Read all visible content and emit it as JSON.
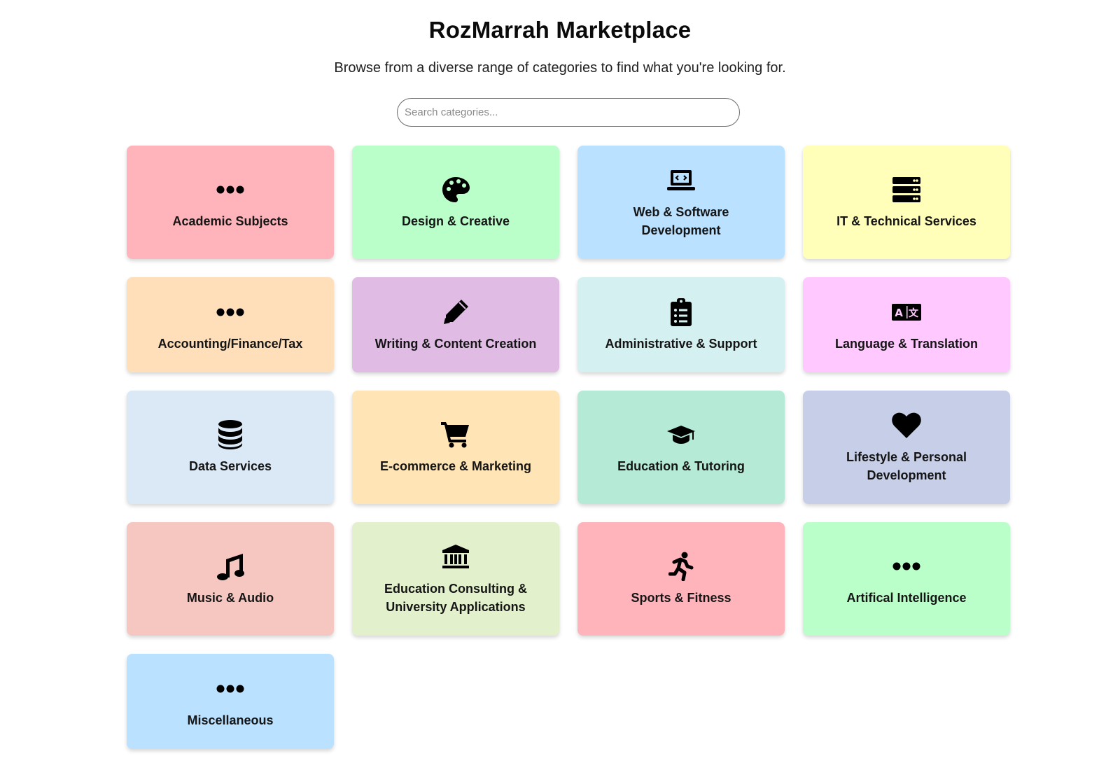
{
  "header": {
    "title": "RozMarrah Marketplace",
    "subtitle": "Browse from a diverse range of categories to find what you're looking for."
  },
  "search": {
    "placeholder": "Search categories...",
    "value": ""
  },
  "categories": [
    {
      "label": "Academic Subjects",
      "icon": "ellipsis-icon",
      "color": "#ffb3ba"
    },
    {
      "label": "Design & Creative",
      "icon": "palette-icon",
      "color": "#baffc9"
    },
    {
      "label": "Web & Software Development",
      "icon": "laptop-code-icon",
      "color": "#bae1ff"
    },
    {
      "label": "IT & Technical Services",
      "icon": "server-icon",
      "color": "#ffffba"
    },
    {
      "label": "Accounting/Finance/Tax",
      "icon": "ellipsis-icon",
      "color": "#ffdfba"
    },
    {
      "label": "Writing & Content Creation",
      "icon": "pencil-icon",
      "color": "#e0bbe4"
    },
    {
      "label": "Administrative & Support",
      "icon": "clipboard-list-icon",
      "color": "#d5f0f0"
    },
    {
      "label": "Language & Translation",
      "icon": "language-icon",
      "color": "#ffc8ff"
    },
    {
      "label": "Data Services",
      "icon": "database-icon",
      "color": "#dbe9f7"
    },
    {
      "label": "E-commerce & Marketing",
      "icon": "shopping-cart-icon",
      "color": "#ffe4b5"
    },
    {
      "label": "Education & Tutoring",
      "icon": "graduation-cap-icon",
      "color": "#b5ead7"
    },
    {
      "label": "Lifestyle & Personal Development",
      "icon": "heart-icon",
      "color": "#c7cee8"
    },
    {
      "label": "Music & Audio",
      "icon": "music-icon",
      "color": "#f6c7c0"
    },
    {
      "label": "Education Consulting & University Applications",
      "icon": "landmark-icon",
      "color": "#e2f0cb"
    },
    {
      "label": "Sports & Fitness",
      "icon": "running-icon",
      "color": "#ffb3ba"
    },
    {
      "label": "Artifical Intelligence",
      "icon": "ellipsis-icon",
      "color": "#baffc9"
    },
    {
      "label": "Miscellaneous",
      "icon": "ellipsis-icon",
      "color": "#bae1ff"
    }
  ]
}
